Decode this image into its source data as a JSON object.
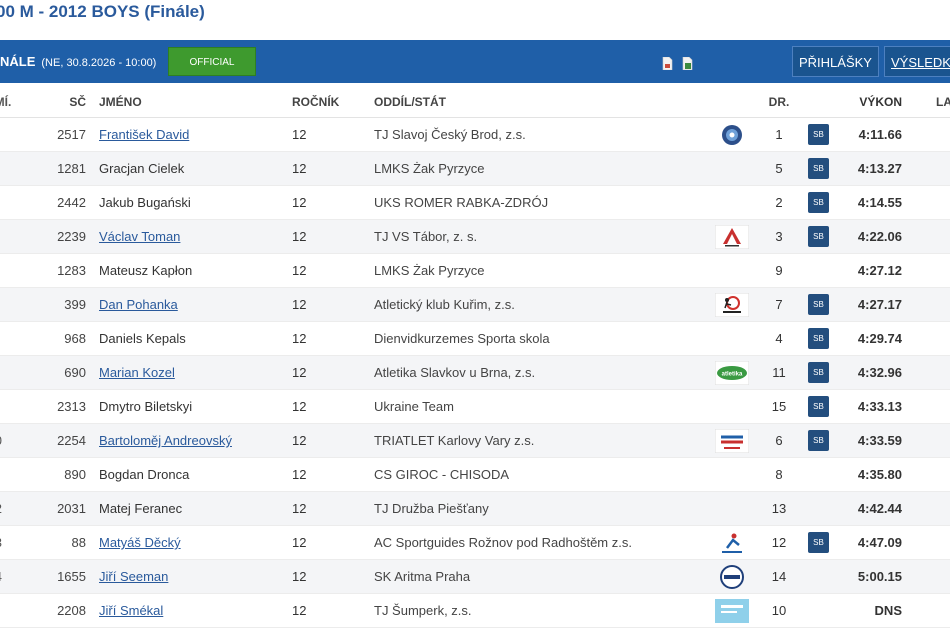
{
  "page": {
    "title": "00 M - 2012 BOYS (Finále)"
  },
  "header": {
    "title": "NÁLE",
    "date": "(NE, 30.8.2026 - 10:00)",
    "status": "OFFICIAL",
    "entries_label": "PŘIHLÁŠKY",
    "results_label": "VÝSLEDKY"
  },
  "columns": {
    "place": "UMÍ.",
    "bib": "SČ",
    "name": "JMÉNO",
    "year": "ROČNÍK",
    "club": "ODDÍL/STÁT",
    "lane": "DR.",
    "performance": "VÝKON",
    "extra": "LA"
  },
  "rows": [
    {
      "place": "",
      "bib": "2517",
      "name": "František David",
      "link": true,
      "year": "12",
      "club": "TJ Slavoj Český Brod, z.s.",
      "logo": "slavoj-logo",
      "lane": "1",
      "badge": "SB",
      "perf": "4:11.66"
    },
    {
      "place": "",
      "bib": "1281",
      "name": "Gracjan Cielek",
      "link": false,
      "year": "12",
      "club": "LMKS Żak Pyrzyce",
      "logo": "",
      "lane": "5",
      "badge": "SB",
      "perf": "4:13.27"
    },
    {
      "place": "",
      "bib": "2442",
      "name": "Jakub Bugański",
      "link": false,
      "year": "12",
      "club": "UKS ROMER RABKA-ZDRÓJ",
      "logo": "",
      "lane": "2",
      "badge": "SB",
      "perf": "4:14.55"
    },
    {
      "place": "",
      "bib": "2239",
      "name": "Václav Toman",
      "link": true,
      "year": "12",
      "club": "TJ VS Tábor, z. s.",
      "logo": "tabor-logo",
      "lane": "3",
      "badge": "SB",
      "perf": "4:22.06"
    },
    {
      "place": "",
      "bib": "1283",
      "name": "Mateusz Kapłon",
      "link": false,
      "year": "12",
      "club": "LMKS Żak Pyrzyce",
      "logo": "",
      "lane": "9",
      "badge": "",
      "perf": "4:27.12"
    },
    {
      "place": "",
      "bib": "399",
      "name": "Dan Pohanka",
      "link": true,
      "year": "12",
      "club": "Atletický klub Kuřim, z.s.",
      "logo": "kurim-logo",
      "lane": "7",
      "badge": "SB",
      "perf": "4:27.17"
    },
    {
      "place": "",
      "bib": "968",
      "name": "Daniels Kepals",
      "link": false,
      "year": "12",
      "club": "Dienvidkurzemes Sporta skola",
      "logo": "",
      "lane": "4",
      "badge": "SB",
      "perf": "4:29.74"
    },
    {
      "place": "",
      "bib": "690",
      "name": "Marian Kozel",
      "link": true,
      "year": "12",
      "club": "Atletika Slavkov u Brna, z.s.",
      "logo": "slavkov-logo",
      "lane": "11",
      "badge": "SB",
      "perf": "4:32.96"
    },
    {
      "place": "",
      "bib": "2313",
      "name": "Dmytro Biletskyi",
      "link": false,
      "year": "12",
      "club": "Ukraine Team",
      "logo": "",
      "lane": "15",
      "badge": "SB",
      "perf": "4:33.13"
    },
    {
      "place": "0",
      "bib": "2254",
      "name": "Bartoloměj Andreovský",
      "link": true,
      "year": "12",
      "club": "TRIATLET Karlovy Vary z.s.",
      "logo": "triatlet-logo",
      "lane": "6",
      "badge": "SB",
      "perf": "4:33.59"
    },
    {
      "place": "",
      "bib": "890",
      "name": "Bogdan Dronca",
      "link": false,
      "year": "12",
      "club": "CS GIROC - CHISODA",
      "logo": "",
      "lane": "8",
      "badge": "",
      "perf": "4:35.80"
    },
    {
      "place": "2",
      "bib": "2031",
      "name": "Matej Feranec",
      "link": false,
      "year": "12",
      "club": "TJ Družba Piešťany",
      "logo": "",
      "lane": "13",
      "badge": "",
      "perf": "4:42.44"
    },
    {
      "place": "3",
      "bib": "88",
      "name": "Matyáš Děcký",
      "link": true,
      "year": "12",
      "club": "AC Sportguides Rožnov pod Radhoštěm z.s.",
      "logo": "sportguides-logo",
      "lane": "12",
      "badge": "SB",
      "perf": "4:47.09"
    },
    {
      "place": "4",
      "bib": "1655",
      "name": "Jiří Seeman",
      "link": true,
      "year": "12",
      "club": "SK Aritma Praha",
      "logo": "aritma-logo",
      "lane": "14",
      "badge": "",
      "perf": "5:00.15"
    },
    {
      "place": "",
      "bib": "2208",
      "name": "Jiří Smékal",
      "link": true,
      "year": "12",
      "club": "TJ Šumperk, z.s.",
      "logo": "sumperk-logo",
      "lane": "10",
      "badge": "",
      "perf": "DNS"
    }
  ]
}
